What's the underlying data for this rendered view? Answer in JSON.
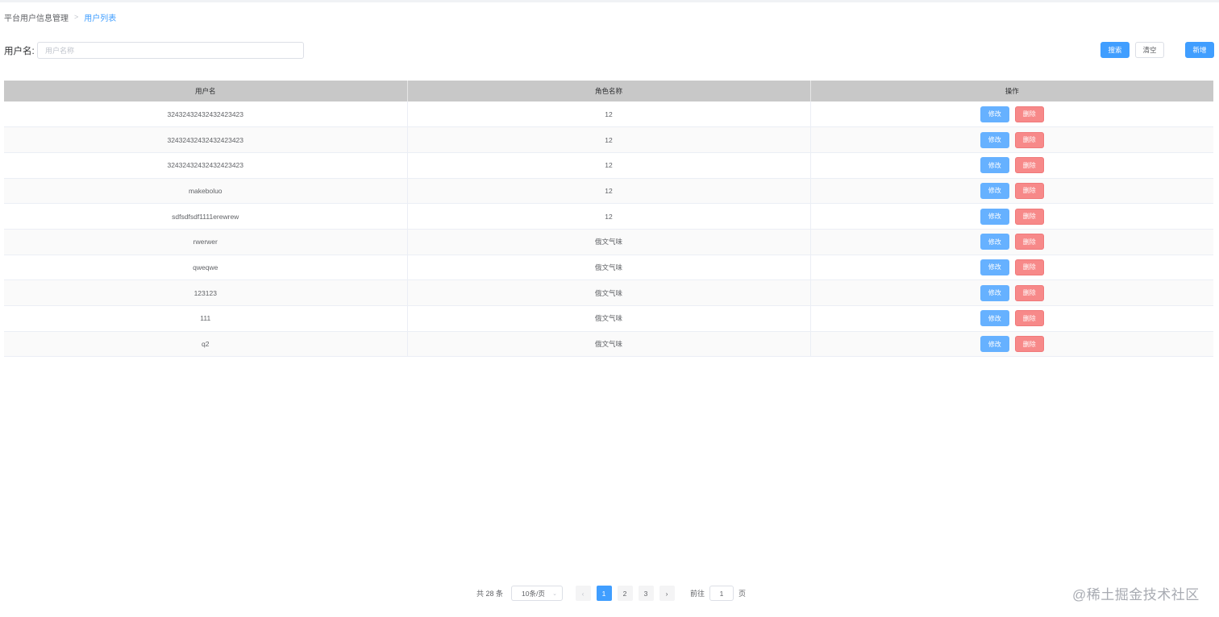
{
  "breadcrumb": {
    "parent": "平台用户信息管理",
    "separator": ">",
    "current": "用户列表"
  },
  "search": {
    "label": "用户名:",
    "value": "",
    "placeholder": "用户名称",
    "search_label": "搜索",
    "clear_label": "清空",
    "add_label": "新增"
  },
  "table": {
    "headers": [
      "用户名",
      "角色名称",
      "操作"
    ],
    "edit_label": "修改",
    "delete_label": "删除",
    "rows": [
      {
        "username": "32432432432432423423",
        "role": "12"
      },
      {
        "username": "32432432432432423423",
        "role": "12"
      },
      {
        "username": "32432432432432423423",
        "role": "12"
      },
      {
        "username": "makeboluo",
        "role": "12"
      },
      {
        "username": "sdfsdfsdf1111erewrew",
        "role": "12"
      },
      {
        "username": "rwerwer",
        "role": "俄文气味"
      },
      {
        "username": "qweqwe",
        "role": "俄文气味"
      },
      {
        "username": "123123",
        "role": "俄文气味"
      },
      {
        "username": "111",
        "role": "俄文气味"
      },
      {
        "username": "q2",
        "role": "俄文气味"
      }
    ]
  },
  "pagination": {
    "total_text": "共 28 条",
    "page_size_text": "10条/页",
    "prev_icon": "chevron-left-icon",
    "next_icon": "chevron-right-icon",
    "pages": [
      "1",
      "2",
      "3"
    ],
    "current_page": "1",
    "jump_label": "前往",
    "jump_value": "1",
    "jump_suffix": "页"
  },
  "watermark": "@稀土掘金技术社区",
  "colors": {
    "primary": "#409eff",
    "edit": "#66b1ff",
    "delete": "#f78989",
    "header_bg": "#c8c8c8"
  }
}
